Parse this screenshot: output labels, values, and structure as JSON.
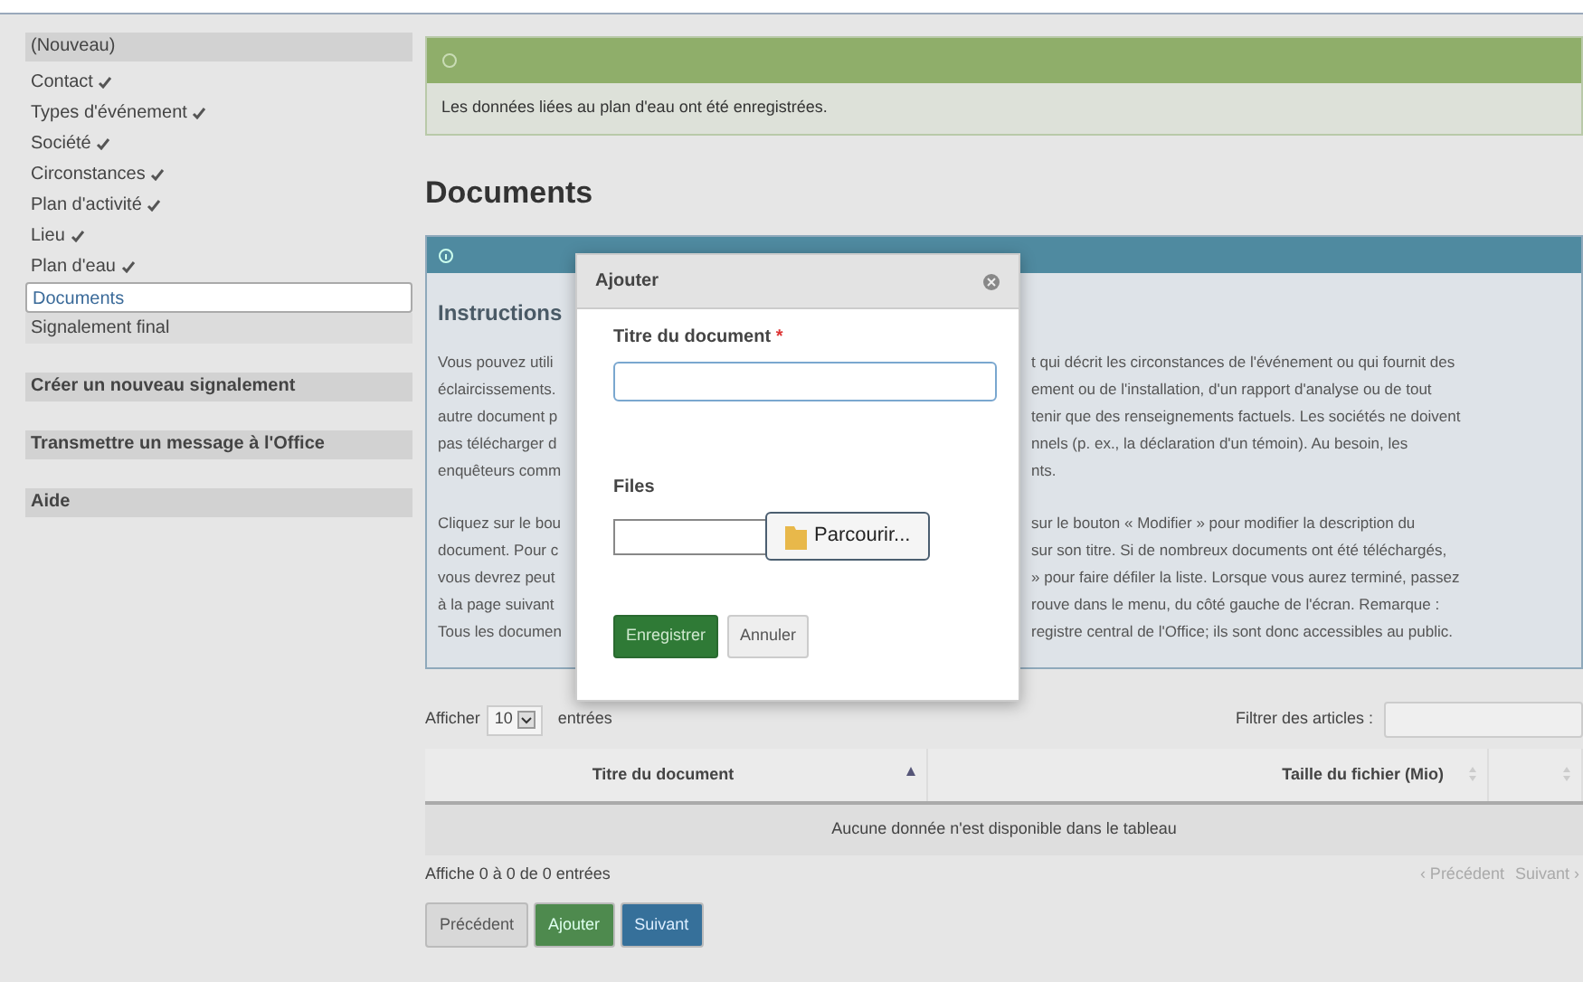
{
  "sidebar": {
    "items": [
      {
        "label": "(Nouveau)",
        "kind": "header",
        "done": false,
        "selected": false
      },
      {
        "label": "Contact",
        "kind": "item",
        "done": true,
        "selected": false
      },
      {
        "label": "Types d'événement",
        "kind": "item",
        "done": true,
        "selected": false
      },
      {
        "label": "Société",
        "kind": "item",
        "done": true,
        "selected": false
      },
      {
        "label": "Circonstances",
        "kind": "item",
        "done": true,
        "selected": false
      },
      {
        "label": "Plan d'activité",
        "kind": "item",
        "done": true,
        "selected": false
      },
      {
        "label": "Lieu",
        "kind": "item",
        "done": true,
        "selected": false
      },
      {
        "label": "Plan d'eau",
        "kind": "item",
        "done": true,
        "selected": false
      },
      {
        "label": "Documents",
        "kind": "item",
        "done": false,
        "selected": true
      },
      {
        "label": "Signalement final",
        "kind": "item",
        "done": false,
        "selected": false
      }
    ],
    "actions": [
      "Créer un nouveau signalement",
      "Transmettre un message à l'Office",
      "Aide"
    ]
  },
  "notice": {
    "message": "Les données liées au plan d'eau ont été enregistrées."
  },
  "page_title": "Documents",
  "instructions": {
    "title": "Instructions",
    "lines": [
      {
        "left": "Vous pouvez utili",
        "right": "t qui décrit les circonstances de l'événement ou qui fournit des"
      },
      {
        "left": "éclaircissements.",
        "right": "ement ou de l'installation, d'un rapport d'analyse ou de tout"
      },
      {
        "left": "autre document p",
        "right": "tenir que des renseignements factuels. Les sociétés ne doivent"
      },
      {
        "left": "pas télécharger d",
        "right": "nnels (p. ex., la déclaration d'un témoin). Au besoin, les"
      },
      {
        "left": "enquêteurs comm",
        "right": "nts."
      },
      {
        "left": "Cliquez sur le bou",
        "right": "sur le bouton « Modifier » pour modifier la description du"
      },
      {
        "left": "document. Pour c",
        "right": "sur son titre. Si de nombreux documents ont été téléchargés,"
      },
      {
        "left": "vous devrez peut",
        "right": "» pour faire défiler la liste. Lorsque vous aurez terminé, passez"
      },
      {
        "left": "à la page suivant",
        "right": "rouve dans le menu, du côté gauche de l'écran. Remarque :"
      },
      {
        "left": "Tous les documen",
        "right": "registre central de l'Office; ils sont donc accessibles au public."
      }
    ]
  },
  "dialog": {
    "title": "Ajouter",
    "title_label": "Titre du document",
    "required_mark": "*",
    "files_label": "Files",
    "browse": "Parcourir...",
    "buttons": [
      {
        "label": "Enregistrer",
        "kind": "primary"
      },
      {
        "label": "Annuler",
        "kind": "default"
      }
    ]
  },
  "table": {
    "show_label": "Afficher",
    "length": "10",
    "entries_label": "entrées",
    "filter_label": "Filtrer des articles :",
    "columns": [
      {
        "label": "Titre du document",
        "sorted": true
      },
      {
        "label": "Taille du fichier (Mio)",
        "sorted": false
      },
      {
        "sorted": false
      }
    ],
    "empty": "Aucune donnée n'est disponible dans le tableau",
    "info": "Affiche 0 à 0 de 0 entrées",
    "pagination": [
      "‹ Précédent",
      "Suivant ›"
    ]
  },
  "buttons": [
    {
      "label": "Précédent",
      "kind": "default"
    },
    {
      "label": "Ajouter",
      "kind": "success"
    },
    {
      "label": "Suivant",
      "kind": "primary"
    }
  ]
}
